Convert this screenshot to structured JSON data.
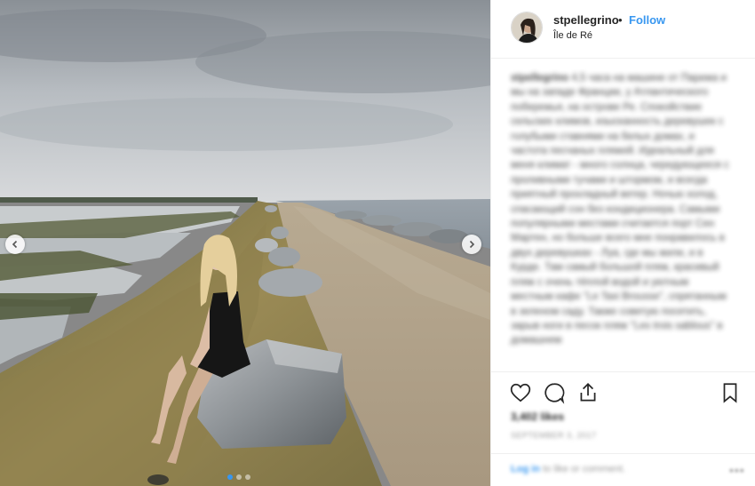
{
  "post": {
    "username": "stpellegrino",
    "separator": "•",
    "follow_label": "Follow",
    "location": "Île de Ré"
  },
  "caption": {
    "author": "stpellegrino",
    "text": "4,5 часа на машине от Парижа и мы на западе Франции, у Атлантического побережья, на острове Ре. Спокойствие сельских климов, изысканность деревушек с голубыми ставнями на белых домах, и частота песчаных пляжей. Идеальный для меня климат - много солнца, чередующееся с проливными тучами и штормом, и всегда приятный прохладный ветер. Ночью холод, спасающий сон без кондиционера. Самыми популярными местами считается порт Сен Мартен, но больше всего мне понравилось в двух деревушках - Луа, где мы жили, и в Курде. Там самый большой пляж, красивый пляж с очень тёплой водой и уютным местным кафе \"Le Taxi Brousse\", спрятанным в зеленом саду. Также советую посетить, зарыв ноги в песок пляж \"Les trois sablous\" в домашнем"
  },
  "stats": {
    "likes": "3,402 likes",
    "date": "SEPTEMBER 3, 2017"
  },
  "comment_bar": {
    "login": "Log in",
    "rest": "to like or comment.",
    "more": "•••"
  },
  "icons": {
    "heart": "heart-icon",
    "comment": "comment-icon",
    "share": "share-icon",
    "bookmark": "bookmark-icon",
    "prev": "chevron-left-icon",
    "next": "chevron-right-icon"
  },
  "colors": {
    "accent": "#3897f0",
    "text": "#262626",
    "muted": "#999999",
    "border": "#efefef"
  },
  "carousel": {
    "current": 1,
    "total": 3
  }
}
